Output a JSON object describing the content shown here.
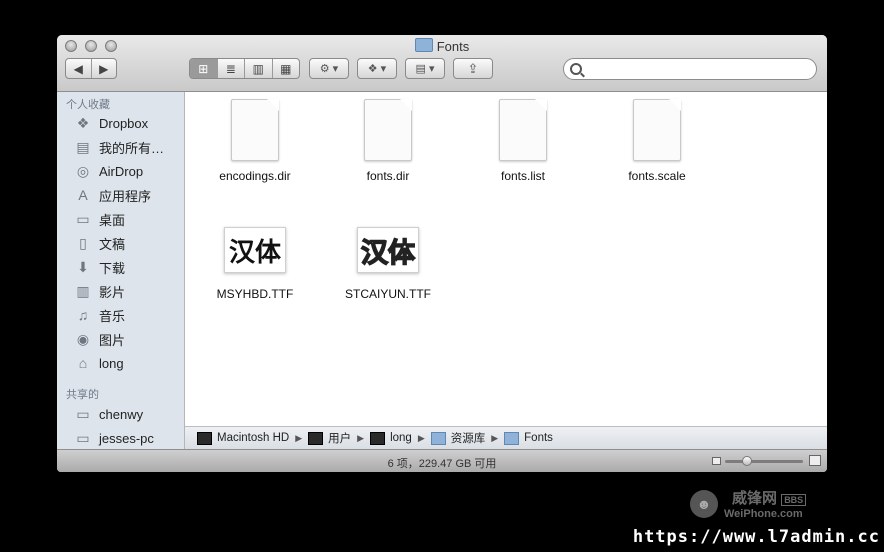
{
  "window": {
    "title": "Fonts"
  },
  "toolbar": {
    "back_icon": "◀",
    "forward_icon": "▶",
    "view_icons": "⊞",
    "view_list": "≣",
    "view_columns": "▥",
    "view_flow": "▦",
    "action": "⚙ ▾",
    "dropbox": "❖ ▾",
    "arrange": "▤ ▾",
    "share": "⇪",
    "search_placeholder": ""
  },
  "sidebar": {
    "favorites_header": "个人收藏",
    "favorites": [
      {
        "label": "Dropbox",
        "icon": "dropbox-icon",
        "glyph": "❖"
      },
      {
        "label": "我的所有…",
        "icon": "all-files-icon",
        "glyph": "▤"
      },
      {
        "label": "AirDrop",
        "icon": "airdrop-icon",
        "glyph": "◎"
      },
      {
        "label": "应用程序",
        "icon": "applications-icon",
        "glyph": "A"
      },
      {
        "label": "桌面",
        "icon": "desktop-icon",
        "glyph": "▭"
      },
      {
        "label": "文稿",
        "icon": "documents-icon",
        "glyph": "▯"
      },
      {
        "label": "下载",
        "icon": "downloads-icon",
        "glyph": "⬇"
      },
      {
        "label": "影片",
        "icon": "movies-icon",
        "glyph": "▥"
      },
      {
        "label": "音乐",
        "icon": "music-icon",
        "glyph": "♫"
      },
      {
        "label": "图片",
        "icon": "pictures-icon",
        "glyph": "◉"
      },
      {
        "label": "long",
        "icon": "home-icon",
        "glyph": "⌂"
      }
    ],
    "shared_header": "共享的",
    "shared": [
      {
        "label": "chenwy",
        "icon": "computer-icon",
        "glyph": "▭"
      },
      {
        "label": "jesses-pc",
        "icon": "computer-icon",
        "glyph": "▭"
      }
    ]
  },
  "files": [
    {
      "name": "encodings.dir",
      "type": "doc"
    },
    {
      "name": "fonts.dir",
      "type": "doc"
    },
    {
      "name": "fonts.list",
      "type": "doc"
    },
    {
      "name": "fonts.scale",
      "type": "doc"
    },
    {
      "name": "MSYHBD.TTF",
      "type": "font",
      "preview": "汉体"
    },
    {
      "name": "STCAIYUN.TTF",
      "type": "font",
      "preview": "汉体"
    }
  ],
  "pathbar": [
    {
      "label": "Macintosh HD"
    },
    {
      "label": "用户"
    },
    {
      "label": "long"
    },
    {
      "label": "资源库"
    },
    {
      "label": "Fonts"
    }
  ],
  "status": {
    "text": "6 项，229.47 GB 可用",
    "icon_size_fraction": 0.25
  },
  "watermark": {
    "site": "威锋网",
    "badge": "BBS",
    "domain": "WeiPhone.com",
    "url": "https://www.l7admin.cc"
  }
}
